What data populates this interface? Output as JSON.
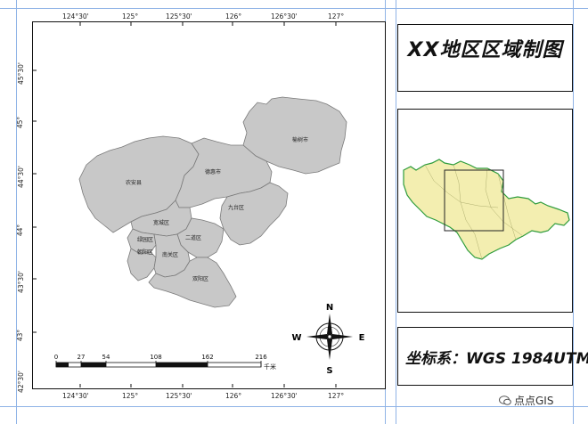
{
  "top_ticks": [
    "124°30'",
    "125°",
    "125°30'",
    "126°",
    "126°30'",
    "127°"
  ],
  "bottom_ticks": [
    "124°30'",
    "125°",
    "125°30'",
    "126°",
    "126°30'",
    "127°"
  ],
  "left_ticks": [
    "45°30'",
    "45°",
    "44°30'",
    "44°",
    "43°30'",
    "43°",
    "42°30'"
  ],
  "districts": {
    "nongan": "农安县",
    "yushu": "榆树市",
    "dehui": "德惠市",
    "jiutai": "九台区",
    "kuancheng": "宽城区",
    "lvyuan": "绿园区",
    "erdao": "二道区",
    "chaoyang": "朝阳区",
    "nanguan": "南关区",
    "shuangyang": "双阳区"
  },
  "scale_bar": {
    "labels": [
      "0",
      "27",
      "54",
      "108",
      "162",
      "216"
    ],
    "unit": "千米"
  },
  "north_arrow": {
    "n": "N",
    "s": "S",
    "e": "E",
    "w": "W"
  },
  "title": "XX地区区域制图",
  "coordinate_system": "坐标系：WGS 1984UTM",
  "watermark": "点点GIS",
  "colors": {
    "district_fill": "#c8c8c8",
    "inset_fill": "#f3eeb0",
    "inset_border": "#2e9c3c",
    "frame": "#111111"
  }
}
